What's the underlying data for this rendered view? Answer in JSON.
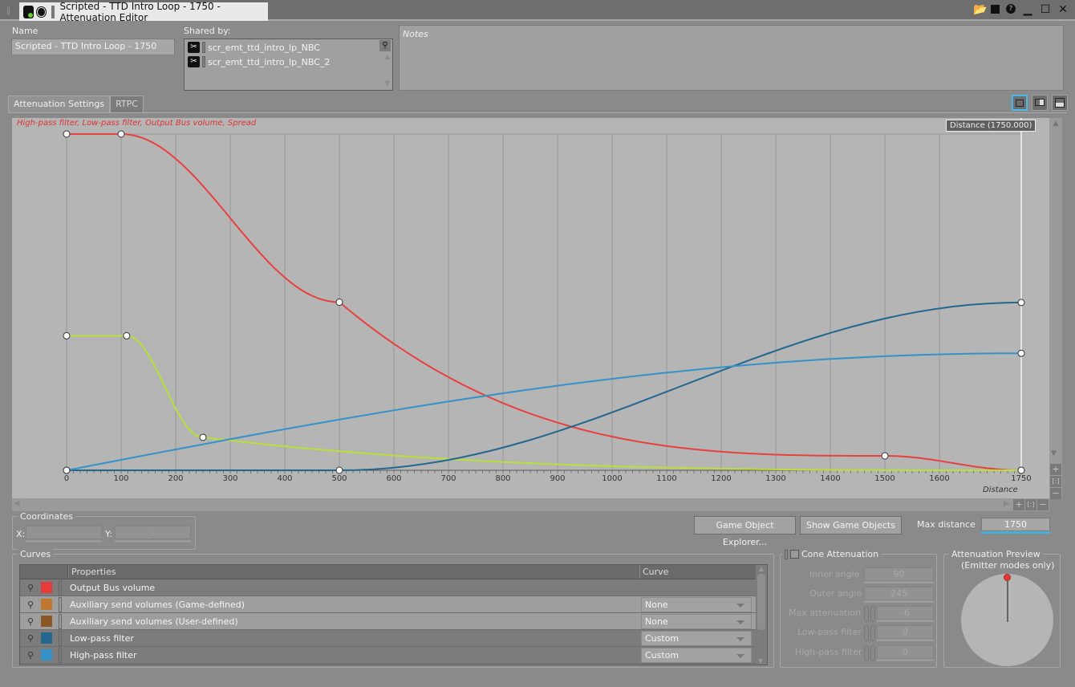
{
  "window": {
    "title": "Scripted - TTD Intro Loop - 1750 - Attenuation Editor",
    "buttons": [
      "open-folder",
      "save",
      "help",
      "minimize",
      "maximize",
      "close"
    ]
  },
  "header": {
    "name_label": "Name",
    "name_value": "Scripted - TTD Intro Loop - 1750",
    "shared_by_label": "Shared by:",
    "shared_by": [
      "scr_emt_ttd_intro_lp_NBC",
      "scr_emt_ttd_intro_lp_NBC_2"
    ],
    "notes_placeholder": "Notes"
  },
  "tabs": [
    {
      "label": "Attenuation Settings",
      "active": true
    },
    {
      "label": "RTPC",
      "active": false
    }
  ],
  "graph": {
    "title": "High-pass filter, Low-pass filter, Output Bus volume, Spread",
    "cursor_label": "Distance (1750.000)",
    "xlabel": "Distance"
  },
  "chart_data": {
    "type": "line",
    "title": "High-pass filter, Low-pass filter, Output Bus volume, Spread",
    "xlabel": "Distance",
    "ylabel": "",
    "xlim": [
      0,
      1750
    ],
    "ylim": [
      0,
      1
    ],
    "x_ticks": [
      0,
      100,
      200,
      300,
      400,
      500,
      600,
      700,
      800,
      900,
      1000,
      1100,
      1200,
      1300,
      1400,
      1500,
      1600,
      1750
    ],
    "grid": true,
    "series": [
      {
        "name": "Output Bus volume",
        "color": "#e8403f",
        "points": [
          [
            0,
            1.0
          ],
          [
            100,
            1.0
          ],
          [
            500,
            0.5
          ],
          [
            1500,
            0.043
          ],
          [
            1750,
            0.0
          ]
        ],
        "shape": [
          "linear",
          "scurve",
          "log",
          "scurve"
        ]
      },
      {
        "name": "Spread",
        "color": "#b8e03a",
        "points": [
          [
            0,
            0.4
          ],
          [
            110,
            0.4
          ],
          [
            250,
            0.098
          ],
          [
            1750,
            0.0
          ]
        ],
        "shape": [
          "linear",
          "scurve",
          "exp"
        ]
      },
      {
        "name": "Low-pass filter",
        "color": "#23678f",
        "points": [
          [
            0,
            0.0
          ],
          [
            500,
            0.0
          ],
          [
            1750,
            0.499
          ]
        ],
        "shape": [
          "linear",
          "scurve"
        ]
      },
      {
        "name": "High-pass filter",
        "color": "#3492c8",
        "points": [
          [
            0,
            0.0
          ],
          [
            1750,
            0.348
          ]
        ],
        "shape": [
          "sine"
        ]
      }
    ]
  },
  "coordinates": {
    "label": "Coordinates",
    "x_label": "X:",
    "x_value": "-",
    "y_label": "Y:",
    "y_value": "-"
  },
  "actions": {
    "game_object_explorer": "Game Object Explorer...",
    "show_game_objects": "Show Game Objects",
    "max_distance_label": "Max distance",
    "max_distance_value": "1750"
  },
  "curves": {
    "label": "Curves",
    "columns": [
      "Properties",
      "Curve"
    ],
    "rows": [
      {
        "property": "Output Bus volume",
        "color": "#e8393b",
        "curve": ""
      },
      {
        "property": "Auxiliary send volumes (Game-defined)",
        "color": "#c07830",
        "curve": "None"
      },
      {
        "property": "Auxiliary send volumes (User-defined)",
        "color": "#8c5526",
        "curve": "None"
      },
      {
        "property": "Low-pass filter",
        "color": "#23678f",
        "curve": "Custom"
      },
      {
        "property": "High-pass filter",
        "color": "#3492c8",
        "curve": "Custom"
      }
    ]
  },
  "cone": {
    "label": "Cone Attenuation",
    "enabled": false,
    "inner_angle_label": "Inner angle",
    "inner_angle": "90",
    "outer_angle_label": "Outer angle",
    "outer_angle": "245",
    "max_attenuation_label": "Max attenuation",
    "max_attenuation": "-6",
    "low_pass_label": "Low-pass filter",
    "low_pass": "0",
    "high_pass_label": "High-pass filter",
    "high_pass": "0"
  },
  "preview": {
    "title": "Attenuation Preview",
    "subtitle": "(Emitter modes only)"
  }
}
